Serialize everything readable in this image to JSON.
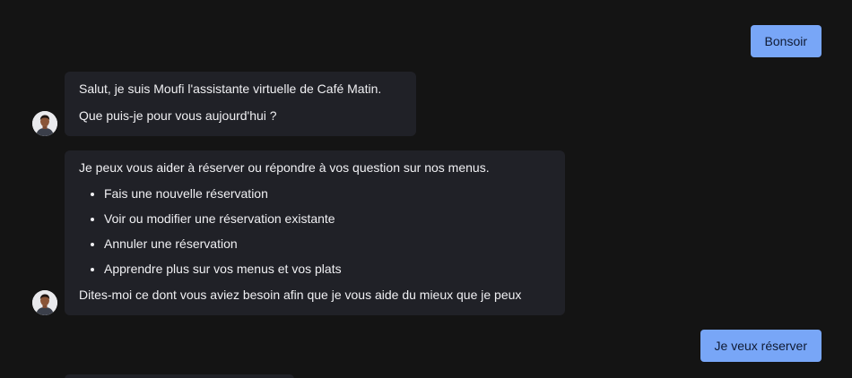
{
  "messages": {
    "user_1": "Bonsoir",
    "bot_1": {
      "line_1": "Salut, je suis Moufi l'assistante virtuelle de Café Matin.",
      "line_2": "Que puis-je pour vous aujourd'hui ?"
    },
    "bot_2": {
      "intro": "Je peux vous aider à réserver ou répondre à vos question sur nos menus.",
      "options": [
        "Fais une nouvelle réservation",
        "Voir ou modifier une réservation existante",
        "Annuler une réservation",
        "Apprendre plus sur vos menus et vos plats"
      ],
      "closing": "Dites-moi ce dont vous aviez besoin afin que je vous aide du mieux que je peux"
    },
    "user_2": "Je veux réserver"
  },
  "colors": {
    "background": "#141414",
    "bot_bubble": "#202127",
    "user_bubble": "#78a6f7"
  },
  "icons": {
    "assistant_avatar": "assistant-avatar-icon"
  }
}
